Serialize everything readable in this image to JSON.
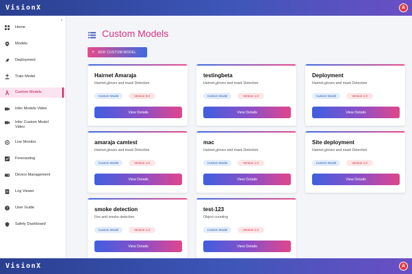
{
  "app": {
    "brand": "VisionX",
    "avatar_initial": "A"
  },
  "sidebar": {
    "items": [
      {
        "label": "Home",
        "icon": "grid-icon"
      },
      {
        "label": "Models",
        "icon": "location-icon"
      },
      {
        "label": "Deployment",
        "icon": "rocket-icon"
      },
      {
        "label": "Train Model",
        "icon": "train-icon"
      },
      {
        "label": "Custom Models",
        "icon": "lambda-icon",
        "active": true
      },
      {
        "label": "Infer Models Video",
        "icon": "video-icon"
      },
      {
        "label": "Infer Custom Model Video",
        "icon": "video-icon"
      },
      {
        "label": "Live Monitor",
        "icon": "monitor-icon"
      },
      {
        "label": "Forecasting",
        "icon": "chart-icon"
      },
      {
        "label": "Device Management",
        "icon": "device-icon"
      },
      {
        "label": "Log Viewer",
        "icon": "log-icon"
      },
      {
        "label": "User Guide",
        "icon": "help-icon"
      },
      {
        "label": "Safety Dashboard",
        "icon": "shield-icon"
      }
    ]
  },
  "main": {
    "title": "Custom Models",
    "add_button": "ADD CUSTOM MODEL",
    "view_label": "View Details",
    "cards": [
      {
        "title": "Hairnet Amaraja",
        "desc": "Hairnet,gloves and mask Detection",
        "type": "Custom Model",
        "version": "Version 6.0"
      },
      {
        "title": "testingbeta",
        "desc": "Hairnet,gloves and mask Detection",
        "type": "Custom Model",
        "version": "Version 1.0"
      },
      {
        "title": "Deployment",
        "desc": "Hairnet,gloves and mask Detection",
        "type": "Custom Model",
        "version": "Version 1.0"
      },
      {
        "title": "amaraja camtest",
        "desc": "Hairnet,gloves and mask Detection",
        "type": "Custom Model",
        "version": "Version 1.0"
      },
      {
        "title": "mac",
        "desc": "Hairnet,gloves and mask Detection",
        "type": "Custom Model",
        "version": "Version 1.0"
      },
      {
        "title": "Site deployment",
        "desc": "Hairnet,gloves and mask Detection",
        "type": "Custom Model",
        "version": "Version 1.0"
      },
      {
        "title": "smoke detection",
        "desc": "Fire and smoke detection",
        "type": "Custom Model",
        "version": "Version 1.0"
      },
      {
        "title": "test-123",
        "desc": "Object counting",
        "type": "Custom Model",
        "version": "Version 1.0"
      }
    ]
  }
}
